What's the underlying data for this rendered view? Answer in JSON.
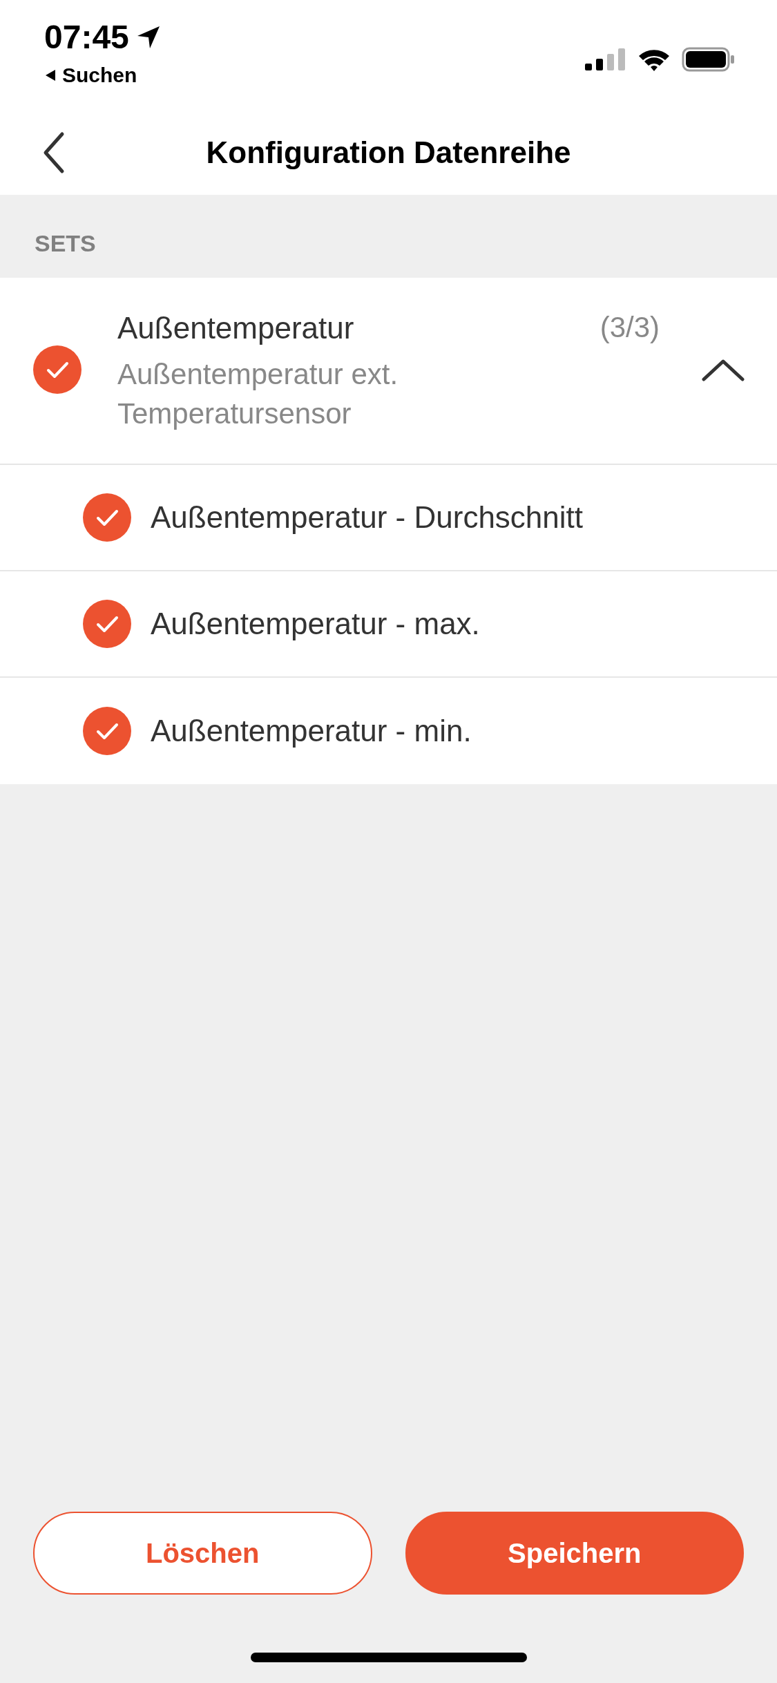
{
  "status_bar": {
    "time": "07:45",
    "back_label": "Suchen"
  },
  "nav": {
    "title": "Konfiguration Datenreihe"
  },
  "section": {
    "header": "SETS"
  },
  "sets": [
    {
      "title": "Außentemperatur",
      "count": "(3/3)",
      "subtitle": "Außentemperatur ext. Temperatursensor",
      "checked": true,
      "expanded": true,
      "children": [
        {
          "label": "Außentemperatur - Durchschnitt",
          "checked": true
        },
        {
          "label": "Außentemperatur - max.",
          "checked": true
        },
        {
          "label": "Außentemperatur - min.",
          "checked": true
        }
      ]
    }
  ],
  "buttons": [
    {
      "label": "Löschen",
      "kind": "outline"
    },
    {
      "label": "Speichern",
      "kind": "filled"
    }
  ]
}
